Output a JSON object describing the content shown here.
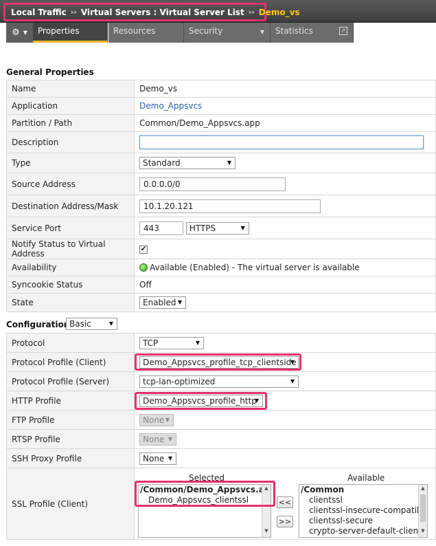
{
  "breadcrumb": {
    "part1": "Local Traffic",
    "sep1": "››",
    "part2": "Virtual Servers : Virtual Server List",
    "sep2": "››",
    "current": "Demo_vs"
  },
  "tabs": [
    "Properties",
    "Resources",
    "Security",
    "Statistics"
  ],
  "general": {
    "title": "General Properties",
    "name_label": "Name",
    "name_value": "Demo_vs",
    "app_label": "Application",
    "app_value": "Demo_Appsvcs",
    "partition_label": "Partition / Path",
    "partition_value": "Common/Demo_Appsvcs.app",
    "description_label": "Description",
    "description_value": "",
    "type_label": "Type",
    "type_value": "Standard",
    "source_label": "Source Address",
    "source_value": "0.0.0.0/0",
    "dest_label": "Destination Address/Mask",
    "dest_value": "10.1.20.121",
    "port_label": "Service Port",
    "port_value": "443",
    "port_service": "HTTPS",
    "notify_label": "Notify Status to Virtual Address",
    "notify_checked": "✔",
    "availability_label": "Availability",
    "availability_value": "Available (Enabled) - The virtual server is available",
    "syncookie_label": "Syncookie Status",
    "syncookie_value": "Off",
    "state_label": "State",
    "state_value": "Enabled"
  },
  "config": {
    "title": "Configuration:",
    "mode": "Basic",
    "protocol_label": "Protocol",
    "protocol_value": "TCP",
    "client_profile_label": "Protocol Profile (Client)",
    "client_profile_value": "Demo_Appsvcs_profile_tcp_clientside",
    "server_profile_label": "Protocol Profile (Server)",
    "server_profile_value": "tcp-lan-optimized",
    "http_label": "HTTP Profile",
    "http_value": "Demo_Appsvcs_profile_http",
    "ftp_label": "FTP Profile",
    "ftp_value": "None",
    "rtsp_label": "RTSP Profile",
    "rtsp_value": "None",
    "ssh_label": "SSH Proxy Profile",
    "ssh_value": "None",
    "ssl_label": "SSL Profile (Client)",
    "selected_header": "Selected",
    "available_header": "Available",
    "selected_group": "/Common/Demo_Appsvcs.app",
    "selected_item": "Demo_Appsvcs_clientssl",
    "available_group": "/Common",
    "available_items": [
      "clientssl",
      "clientssl-insecure-compatible",
      "clientssl-secure",
      "crypto-server-default-clientssl"
    ],
    "btn_add": "<<",
    "btn_remove": ">>"
  },
  "colors": {
    "highlight": "#e8306a",
    "active_tab_underline": "#f3b82b",
    "breadcrumb_current": "#f6c91c"
  }
}
